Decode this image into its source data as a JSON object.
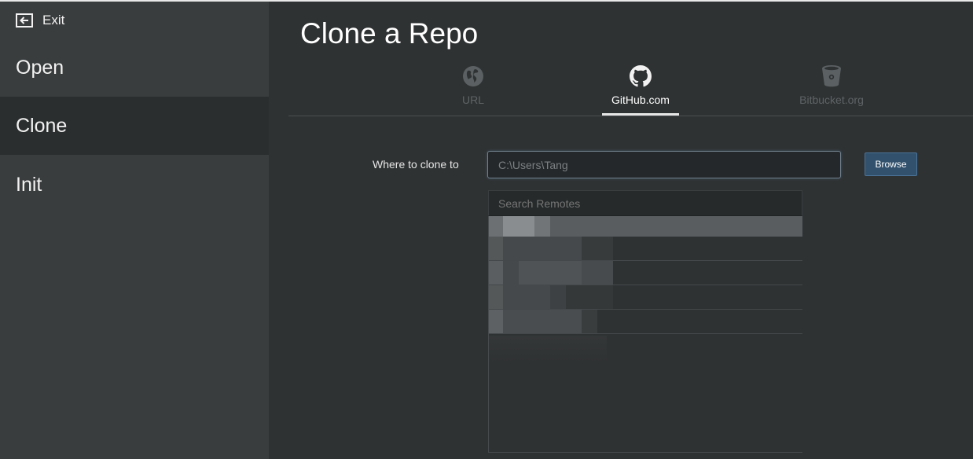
{
  "sidebar": {
    "exit_label": "Exit",
    "items": [
      {
        "label": "Open"
      },
      {
        "label": "Clone"
      },
      {
        "label": "Init"
      }
    ]
  },
  "main": {
    "title": "Clone a Repo",
    "tabs": [
      {
        "label": "URL",
        "icon": "globe-icon"
      },
      {
        "label": "GitHub.com",
        "icon": "github-icon",
        "active": true
      },
      {
        "label": "Bitbucket.org",
        "icon": "bitbucket-icon"
      }
    ],
    "where_label": "Where to clone to",
    "path_value": "C:\\Users\\Tang",
    "browse_label": "Browse",
    "search_placeholder": "Search Remotes"
  },
  "colors": {
    "sidebar_bg": "#3a3d3e",
    "sidebar_selected": "#2b2e2f",
    "main_bg": "#2f3233",
    "accent_button": "#32516d"
  }
}
